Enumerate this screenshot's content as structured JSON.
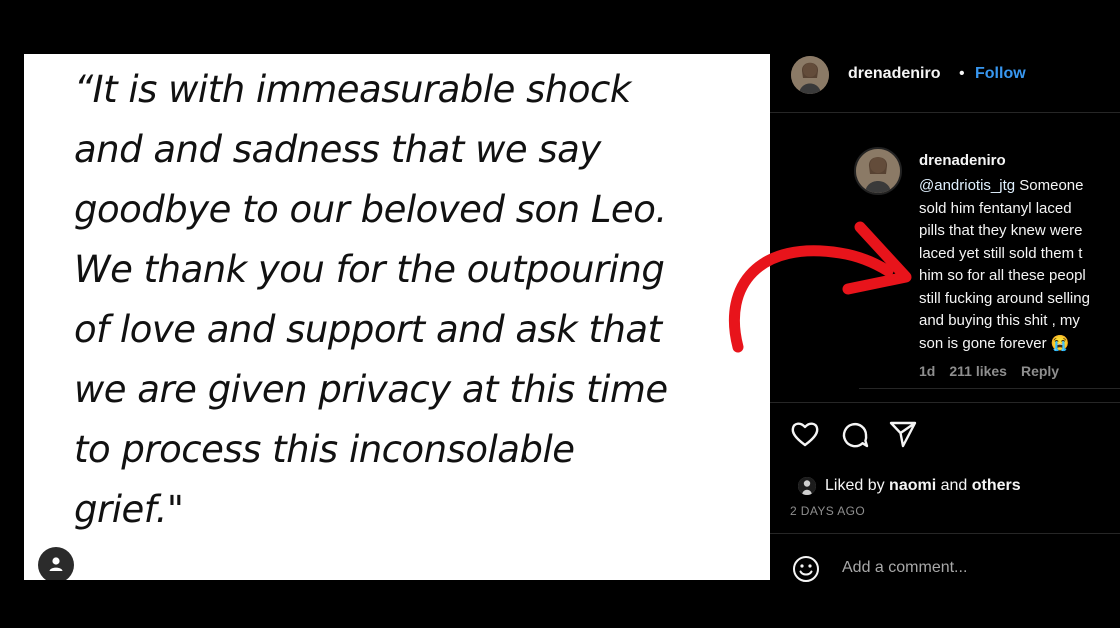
{
  "post": {
    "quote_lines": [
      "“It is with immeasurable shock",
      "and and sadness that we say",
      "goodbye to our beloved son Leo.",
      "We thank you for the outpouring",
      "of love and support and ask that",
      "we are given privacy at this time",
      "to process this inconsolable",
      "grief.\""
    ]
  },
  "header": {
    "username": "drenadeniro",
    "separator": "•",
    "follow_label": "Follow"
  },
  "comment": {
    "username": "drenadeniro",
    "mention": "@andriotis_jtg",
    "lines": [
      "Someone",
      "sold him fentanyl laced",
      "pills that they knew were",
      "laced yet still sold them t",
      "him so for all these peopl",
      "still fucking around selling",
      "and buying this shit , my",
      "son is gone forever"
    ],
    "emoji": "😭",
    "age": "1d",
    "likes": "211 likes",
    "reply_label": "Reply"
  },
  "actions": {
    "icons": [
      "heart-icon",
      "comment-icon",
      "share-icon"
    ],
    "liked_prefix": "Liked by",
    "liked_user": "naomi",
    "liked_and": "and",
    "liked_others": "others",
    "time": "2 DAYS AGO"
  },
  "add_comment": {
    "placeholder": "Add a comment..."
  },
  "colors": {
    "accent": "#3897f0",
    "arrow": "#e8141b",
    "background": "#000000",
    "post_bg": "#ffffff"
  }
}
